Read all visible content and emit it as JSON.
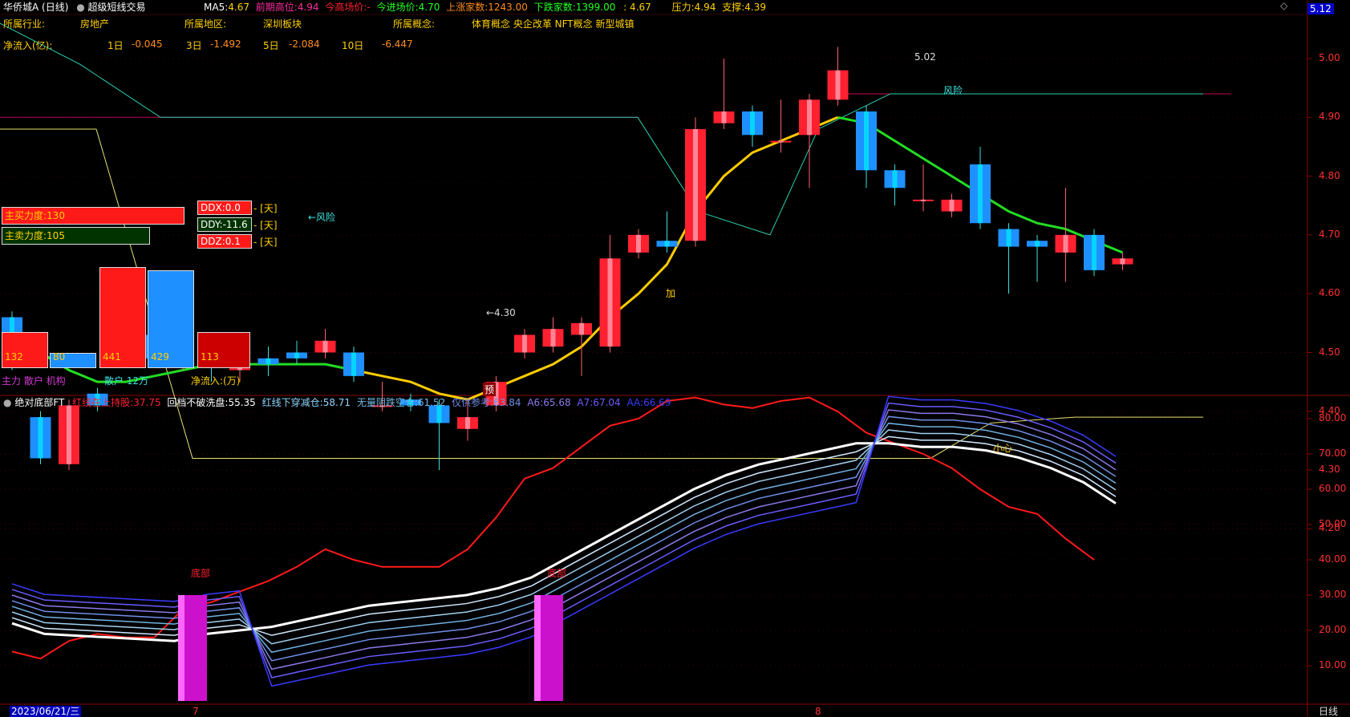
{
  "header": {
    "stock": "华侨城A (日线)",
    "indicator": "超级短线交易",
    "ma5_label": "MA5:",
    "ma5": "4.67",
    "prev_high_label": "前期高位:",
    "prev_high": "4.94",
    "today_price_label": "今高场价:",
    "today_price": "-",
    "buy_in_label": "今进场价:",
    "buy_in": "4.70",
    "up_count_label": "上涨家数:",
    "up_count": "1243.00",
    "down_count_label": "下跌家数:",
    "down_count": "1399.00",
    "extra": ": 4.67",
    "pressure_label": "压力:",
    "pressure": "4.94",
    "support_label": "支撑:",
    "support": "4.39",
    "price_tag": "5.12"
  },
  "info": {
    "industry_label": "所属行业:",
    "industry": "房地产",
    "region_label": "所属地区:",
    "region": "深圳板块",
    "concept_label": "所属概念:",
    "concepts": "体育概念 央企改革 NFT概念 新型城镇",
    "netflow_label": "净流入(亿):",
    "d1_label": "1日",
    "d1": "-0.045",
    "d3_label": "3日",
    "d3": "-1.492",
    "d5_label": "5日",
    "d5": "-2.084",
    "d10_label": "10日",
    "d10": "-6.447"
  },
  "panel": {
    "buy_force": "主买力度:130",
    "sell_force": "主卖力度:105",
    "ddx": "DDX:0.0",
    "ddy": "DDY:-11.6",
    "ddz": "DDZ:0.1",
    "day_tag": "- [天]",
    "vol_values": [
      "132",
      "80",
      "441",
      "429",
      "113"
    ],
    "retail": "散户 12万",
    "net_in": "净流入:(万)",
    "bottom_left": "主力 散户 机构"
  },
  "annotations": {
    "risk1": "←风险",
    "risk2": "风险",
    "high_mark": "5.02",
    "low_mark": "←4.30",
    "add": "加",
    "forecast": "预",
    "bottom1": "底部",
    "bottom2": "底部",
    "careful": "小心"
  },
  "price_axis": [
    "5.00",
    "4.90",
    "4.80",
    "4.70",
    "4.60",
    "4.50",
    "4.40",
    "4.30",
    "4.20"
  ],
  "lower": {
    "name": "绝对底部FT",
    "l1_label": "红线在上持股:",
    "l1": "37.75",
    "l2_label": "回档不破洗盘:",
    "l2": "55.35",
    "l3_label": "红线下穿减仓:",
    "l3": "58.71",
    "l4_label": "无量阴跌空仓:",
    "l4": "61.52",
    "l5_label": "仅供参考:",
    "l5": "63.84",
    "a6_label": "A6:",
    "a6": "65.68",
    "a7_label": "A7:",
    "a7": "67.04",
    "aa_label": "AA:",
    "aa": "66.69"
  },
  "lower_axis": [
    "80.00",
    "70.00",
    "60.00",
    "50.00",
    "40.00",
    "30.00",
    "20.00",
    "10.00"
  ],
  "footer": {
    "date": "2023/06/21/三",
    "m7": "7",
    "m8": "8",
    "period": "日线"
  },
  "colors": {
    "up": "#ff2030",
    "down": "#1e90ff",
    "ma": "#ffcc00",
    "axis": "#8a0000"
  },
  "chart_data": {
    "type": "candlestick",
    "candles": [
      [
        4.56,
        4.48,
        4.57,
        4.47
      ],
      [
        4.39,
        4.32,
        4.4,
        4.31
      ],
      [
        4.31,
        4.41,
        4.42,
        4.3
      ],
      [
        4.43,
        4.41,
        4.44,
        4.4
      ],
      [
        4.49,
        4.52,
        4.53,
        4.48
      ],
      [
        4.53,
        4.49,
        4.55,
        4.48
      ],
      [
        4.48,
        4.51,
        4.52,
        4.47
      ],
      [
        4.5,
        4.49,
        4.52,
        4.45
      ],
      [
        4.47,
        4.48,
        4.5,
        4.45
      ],
      [
        4.49,
        4.48,
        4.51,
        4.46
      ],
      [
        4.5,
        4.49,
        4.52,
        4.48
      ],
      [
        4.5,
        4.52,
        4.54,
        4.49
      ],
      [
        4.5,
        4.46,
        4.51,
        4.45
      ],
      [
        4.41,
        4.41,
        4.45,
        4.4
      ],
      [
        4.42,
        4.41,
        4.43,
        4.4
      ],
      [
        4.41,
        4.38,
        4.42,
        4.3
      ],
      [
        4.37,
        4.39,
        4.42,
        4.35
      ],
      [
        4.41,
        4.45,
        4.46,
        4.4
      ],
      [
        4.5,
        4.53,
        4.54,
        4.49
      ],
      [
        4.51,
        4.54,
        4.56,
        4.5
      ],
      [
        4.53,
        4.55,
        4.56,
        4.46
      ],
      [
        4.51,
        4.66,
        4.7,
        4.5
      ],
      [
        4.67,
        4.7,
        4.71,
        4.66
      ],
      [
        4.69,
        4.68,
        4.74,
        4.67
      ],
      [
        4.69,
        4.88,
        4.9,
        4.68
      ],
      [
        4.89,
        4.91,
        5.0,
        4.88
      ],
      [
        4.91,
        4.87,
        4.92,
        4.85
      ],
      [
        4.86,
        4.86,
        4.93,
        4.84
      ],
      [
        4.87,
        4.93,
        4.94,
        4.78
      ],
      [
        4.93,
        4.98,
        5.02,
        4.92
      ],
      [
        4.91,
        4.81,
        4.92,
        4.78
      ],
      [
        4.81,
        4.78,
        4.82,
        4.75
      ],
      [
        4.76,
        4.76,
        4.82,
        4.74
      ],
      [
        4.74,
        4.76,
        4.77,
        4.73
      ],
      [
        4.82,
        4.72,
        4.85,
        4.71
      ],
      [
        4.71,
        4.68,
        4.72,
        4.6
      ],
      [
        4.69,
        4.68,
        4.7,
        4.62
      ],
      [
        4.67,
        4.7,
        4.78,
        4.62
      ],
      [
        4.7,
        4.64,
        4.71,
        4.63
      ],
      [
        4.65,
        4.66,
        4.67,
        4.64
      ]
    ]
  }
}
